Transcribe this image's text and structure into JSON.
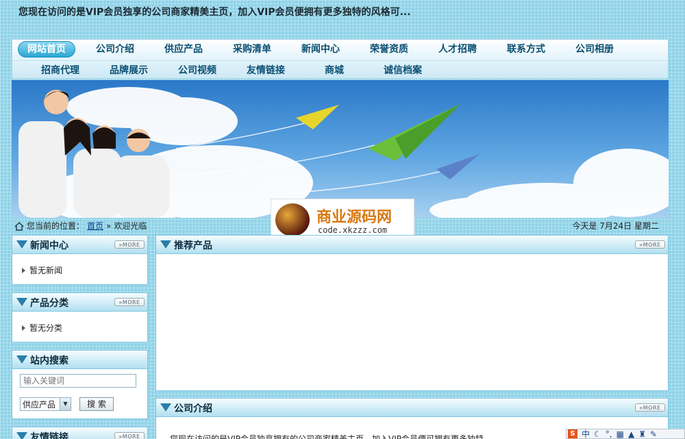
{
  "header": {
    "notice": "您现在访问的是VIP会员独享的公司商家精美主页，加入VIP会员便拥有更多独特的风格可..."
  },
  "nav": {
    "row1": [
      "网站首页",
      "公司介绍",
      "供应产品",
      "采购清单",
      "新闻中心",
      "荣誉资质",
      "人才招聘",
      "联系方式",
      "公司相册"
    ],
    "row2": [
      "招商代理",
      "品牌展示",
      "公司视频",
      "友情链接",
      "商城",
      "诚信档案"
    ]
  },
  "watermark": {
    "title": "商业源码网",
    "url": "code.xkzzz.com"
  },
  "location": {
    "prefix": "您当前的位置：",
    "home_link": "首页",
    "separator": "»",
    "current": "欢迎光临",
    "date": "今天是 7月24日 星期二"
  },
  "sidebar": {
    "news": {
      "title": "新闻中心",
      "more": "MORE",
      "empty": "暂无新闻"
    },
    "category": {
      "title": "产品分类",
      "more": "MORE",
      "empty": "暂无分类"
    },
    "search": {
      "title": "站内搜索",
      "placeholder": "输入关键词",
      "select_value": "供应产品",
      "button": "搜 索"
    },
    "links": {
      "title": "友情链接",
      "more": "MORE"
    }
  },
  "main": {
    "recommend": {
      "title": "推荐产品",
      "more": "MORE"
    },
    "intro": {
      "title": "公司介绍",
      "more": "MORE",
      "text": "您现在访问的是VIP会员独享拥有的公司商家精美主页，加入VIP会员便可拥有更多独特"
    }
  },
  "ime": {
    "lang": "中"
  }
}
